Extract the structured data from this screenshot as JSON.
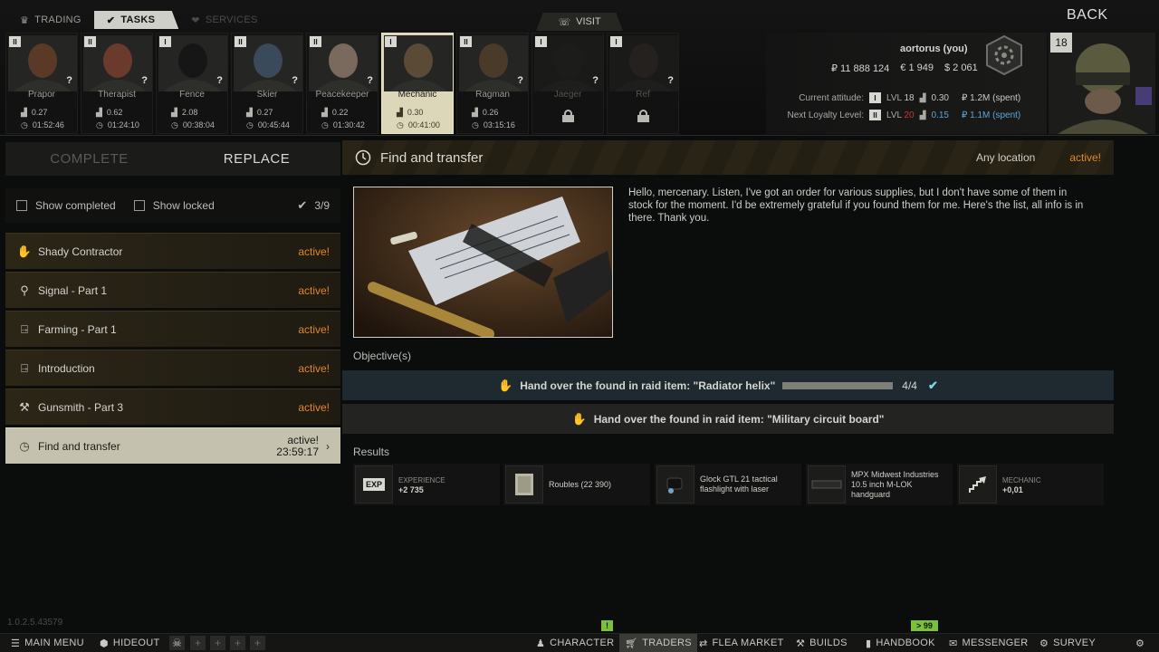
{
  "header": {
    "tabs": [
      {
        "label": "TRADING",
        "icon": "trading-icon"
      },
      {
        "label": "TASKS",
        "icon": "tasks-icon"
      },
      {
        "label": "SERVICES",
        "icon": "services-icon"
      }
    ],
    "visit_label": "VISIT",
    "back_label": "BACK"
  },
  "traders": [
    {
      "name": "Prapor",
      "level": "II",
      "standing": "0.27",
      "timer": "01:52:46",
      "question": "?",
      "locked": false
    },
    {
      "name": "Therapist",
      "level": "II",
      "standing": "0.62",
      "timer": "01:24:10",
      "question": "?",
      "locked": false
    },
    {
      "name": "Fence",
      "level": "I",
      "standing": "2.08",
      "timer": "00:38:04",
      "question": "?",
      "locked": false
    },
    {
      "name": "Skier",
      "level": "II",
      "standing": "0.27",
      "timer": "00:45:44",
      "question": "?",
      "locked": false
    },
    {
      "name": "Peacekeeper",
      "level": "II",
      "standing": "0.22",
      "timer": "01:30:42",
      "question": "?",
      "locked": false
    },
    {
      "name": "Mechanic",
      "level": "I",
      "standing": "0.30",
      "timer": "00:41:00",
      "question": "",
      "locked": false
    },
    {
      "name": "Ragman",
      "level": "II",
      "standing": "0.26",
      "timer": "03:15:16",
      "question": "?",
      "locked": false
    },
    {
      "name": "Jaeger",
      "level": "I",
      "standing": "",
      "timer": "",
      "question": "?",
      "locked": true
    },
    {
      "name": "Ref",
      "level": "I",
      "standing": "",
      "timer": "",
      "question": "?",
      "locked": true
    }
  ],
  "profile": {
    "username": "aortorus (you)",
    "roubles": "₽ 11 888 124",
    "euros": "€ 1 949",
    "dollars": "$ 2 061",
    "player_level": "18",
    "current_attitude": {
      "label": "Current attitude:",
      "badge": "I",
      "lvl": "LVL",
      "lvl_value": "18",
      "standing": "0.30",
      "spent": "₽ 1.2M (spent)"
    },
    "next_loyalty": {
      "label": "Next Loyalty Level:",
      "badge": "II",
      "lvl": "LVL",
      "lvl_value": "20",
      "standing": "0.15",
      "spent": "₽ 1.1M (spent)"
    }
  },
  "left_panel": {
    "complete_label": "COMPLETE",
    "replace_label": "REPLACE",
    "show_completed": "Show completed",
    "show_locked": "Show locked",
    "count": "3/9",
    "quests": [
      {
        "name": "Shady Contractor",
        "status": "active!",
        "icon": "hand-icon"
      },
      {
        "name": "Signal - Part 1",
        "status": "active!",
        "icon": "location-pin-icon"
      },
      {
        "name": "Farming - Part 1",
        "status": "active!",
        "icon": "exit-icon"
      },
      {
        "name": "Introduction",
        "status": "active!",
        "icon": "exit-icon"
      },
      {
        "name": "Gunsmith - Part 3",
        "status": "active!",
        "icon": "wrench-icon"
      }
    ],
    "selected_quest": {
      "name": "Find and transfer",
      "status": "active!",
      "timer": "23:59:17",
      "icon": "clock-icon"
    }
  },
  "quest": {
    "title": "Find and transfer",
    "location": "Any location",
    "status": "active!",
    "description": "Hello, mercenary. Listen, I've got an order for various supplies, but I don't have some of them in stock for the moment. I'd be extremely grateful if you found them for me. Here's the list, all info is in there. Thank you.",
    "objectives_label": "Objective(s)",
    "objectives": [
      {
        "text": "Hand over the found in raid item: \"Radiator helix\"",
        "count": "4/4",
        "progress": 1.0,
        "done": true
      },
      {
        "text": "Hand over the found in raid item: \"Military circuit board\"",
        "done": false
      }
    ],
    "results_label": "Results",
    "rewards": [
      {
        "type": "EXP",
        "label": "EXPERIENCE",
        "value": "+2 735"
      },
      {
        "type": "item",
        "text": "Roubles (22 390)"
      },
      {
        "type": "item",
        "text": "Glock GTL 21 tactical flashlight with laser"
      },
      {
        "type": "item",
        "text": "MPX Midwest Industries 10.5 inch M-LOK handguard"
      },
      {
        "type": "standing",
        "label": "MECHANIC",
        "value": "+0,01"
      }
    ]
  },
  "footer": {
    "version": "1.0.2.5.43579",
    "main_menu": "MAIN MENU",
    "hideout": "HIDEOUT",
    "character": "CHARACTER",
    "traders": "TRADERS",
    "flea_market": "FLEA MARKET",
    "builds": "BUILDS",
    "handbook": "HANDBOOK",
    "messenger": "MESSENGER",
    "survey": "SURVEY",
    "messenger_badge": "> 99",
    "character_badge": "!"
  },
  "colors": {
    "accent_active": "#e0862a",
    "selected_tint": "#dcd7b9",
    "objective_done": "#1e2a2f"
  }
}
